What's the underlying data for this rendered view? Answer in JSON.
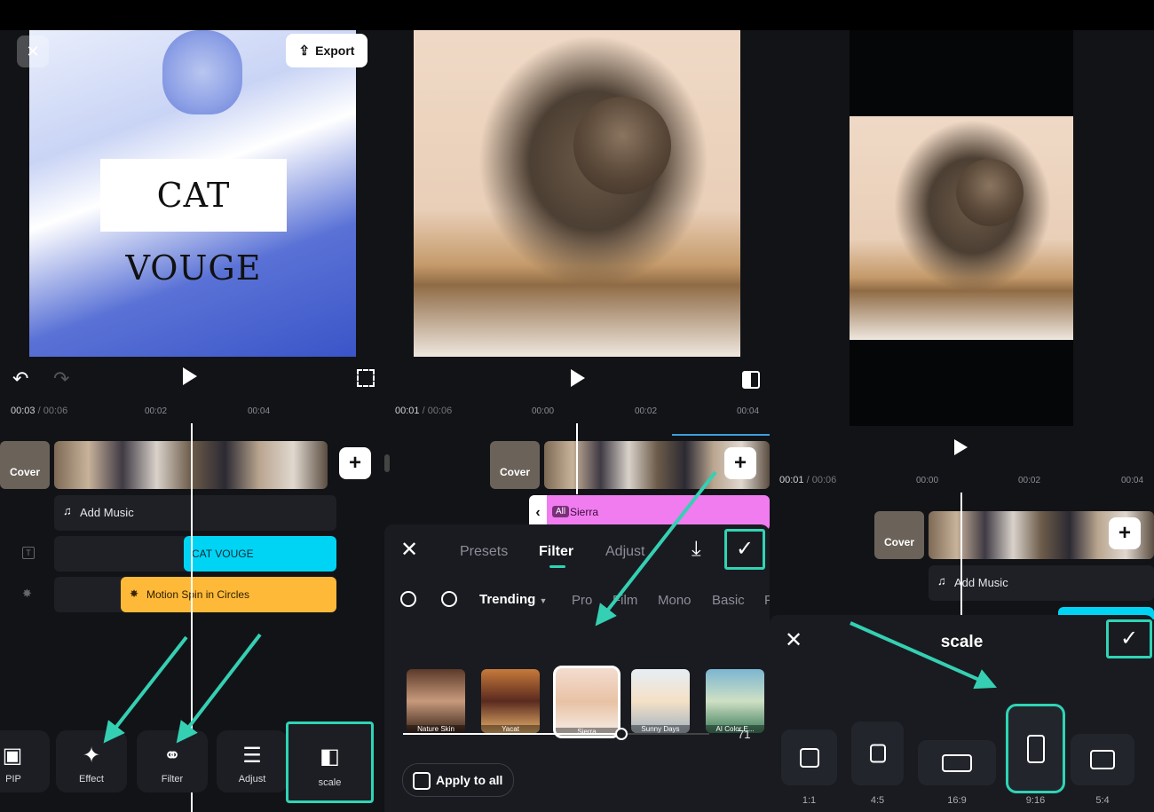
{
  "left": {
    "export_label": "Export",
    "overlay_title": "CAT VOUGE",
    "time_current": "00:03",
    "time_total": "/ 00:06",
    "ticks": [
      "00:02",
      "00:04"
    ],
    "cover_label": "Cover",
    "add_music_label": "Add Music",
    "text_clip_label": "CAT VOUGE",
    "effect_clip_label": "Motion Spin in Circles",
    "tools": [
      {
        "label": "PIP",
        "icon": "pip-icon"
      },
      {
        "label": "Effect",
        "icon": "effect-icon"
      },
      {
        "label": "Filter",
        "icon": "filter-icon"
      },
      {
        "label": "Adjust",
        "icon": "adjust-icon"
      },
      {
        "label": "scale",
        "icon": "scale-icon"
      }
    ]
  },
  "middle": {
    "time_current": "00:01",
    "time_total": "/ 00:06",
    "ticks": [
      "00:00",
      "00:02",
      "00:04"
    ],
    "cover_label": "Cover",
    "filter_chip_tag": "All",
    "filter_chip_label": "Sierra",
    "tabs": [
      "Presets",
      "Filter",
      "Adjust"
    ],
    "active_tab": "Filter",
    "categories": [
      "Trending",
      "Pro",
      "Film",
      "Mono",
      "Basic"
    ],
    "active_category": "Trending",
    "filters": [
      "Nature Skin",
      "Yacat",
      "Sierra",
      "Sunny Days",
      "AI Color E..."
    ],
    "selected_filter": "Sierra",
    "intensity_value": "71",
    "intensity_fraction": 0.71,
    "apply_all_label": "Apply to all"
  },
  "right": {
    "time_current": "00:01",
    "time_total": "/ 00:06",
    "ticks": [
      "00:00",
      "00:02",
      "00:04"
    ],
    "cover_label": "Cover",
    "add_music_label": "Add Music",
    "sheet_title": "scale",
    "ratios": [
      "1:1",
      "4:5",
      "16:9",
      "9:16",
      "5:4"
    ],
    "selected_ratio": "9:16"
  },
  "colors": {
    "accent_teal": "#2fd4b5",
    "text_clip": "#00d4f5",
    "effect_clip": "#ffb938",
    "filter_clip": "#f07cf0"
  }
}
